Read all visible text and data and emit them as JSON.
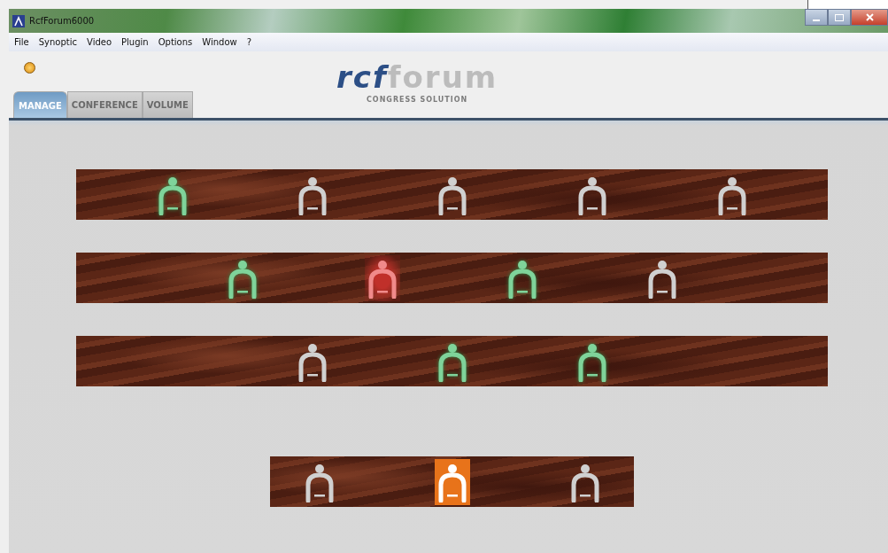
{
  "window": {
    "title": "RcfForum6000"
  },
  "menu": [
    "File",
    "Synoptic",
    "Video",
    "Plugin",
    "Options",
    "Window",
    "?"
  ],
  "logo": {
    "brand_a": "rcf",
    "brand_b": "forum",
    "tagline": "CONGRESS SOLUTION"
  },
  "tabs": [
    {
      "label": "MANAGE",
      "selected": true
    },
    {
      "label": "CONFERENCE",
      "selected": false
    },
    {
      "label": "VOLUME",
      "selected": false
    }
  ],
  "rows": [
    {
      "kind": "delegates",
      "seats": [
        {
          "speaking": true,
          "requesting": false,
          "priority": false
        },
        {
          "speaking": false,
          "requesting": false,
          "priority": false
        },
        {
          "speaking": false,
          "requesting": false,
          "priority": false
        },
        {
          "speaking": false,
          "requesting": false,
          "priority": false
        },
        {
          "speaking": false,
          "requesting": false,
          "priority": false
        }
      ]
    },
    {
      "kind": "delegates",
      "seats": [
        {
          "speaking": true,
          "requesting": false,
          "priority": false
        },
        {
          "speaking": false,
          "requesting": true,
          "priority": false
        },
        {
          "speaking": true,
          "requesting": false,
          "priority": false
        },
        {
          "speaking": false,
          "requesting": false,
          "priority": false
        }
      ]
    },
    {
      "kind": "delegates",
      "seats": [
        {
          "speaking": false,
          "requesting": false,
          "priority": false
        },
        {
          "speaking": true,
          "requesting": false,
          "priority": false
        },
        {
          "speaking": true,
          "requesting": false,
          "priority": false
        }
      ]
    },
    {
      "kind": "presidency",
      "seats": [
        {
          "speaking": false,
          "requesting": false,
          "priority": false
        },
        {
          "speaking": false,
          "requesting": false,
          "priority": true
        },
        {
          "speaking": false,
          "requesting": false,
          "priority": false
        }
      ]
    }
  ]
}
